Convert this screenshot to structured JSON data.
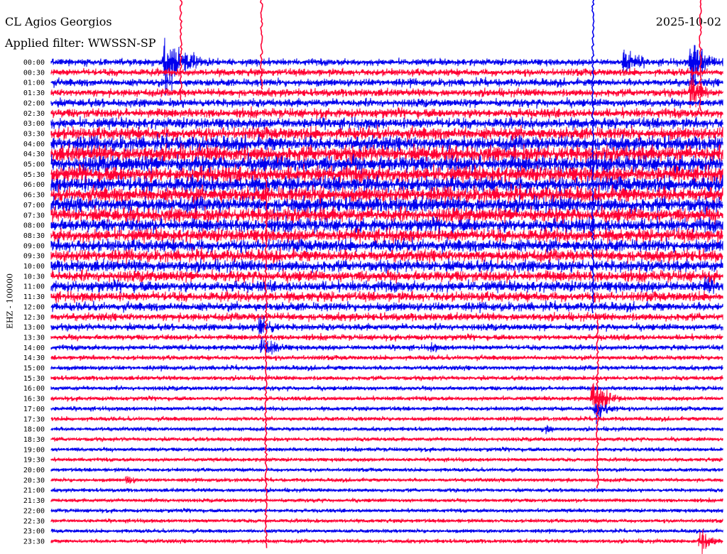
{
  "header": {
    "station": "CL Agios Georgios",
    "filter": "Applied filter: WWSSN-SP",
    "date": "2025-10-02"
  },
  "channel_label": "EHZ - 100000",
  "colors": {
    "trace_a": "#0000ee",
    "trace_b": "#ff0033",
    "background": "#ffffff"
  },
  "chart_data": {
    "type": "line",
    "title": "CL Agios Georgios",
    "subtitle": "Applied filter: WWSSN-SP",
    "date": "2025-10-02",
    "ylabel": "EHZ - 100000",
    "row_interval_minutes": 30,
    "row_labels": [
      "00:00",
      "00:30",
      "01:00",
      "01:30",
      "02:00",
      "02:30",
      "03:00",
      "03:30",
      "04:00",
      "04:30",
      "05:00",
      "05:30",
      "06:00",
      "06:30",
      "07:00",
      "07:30",
      "08:00",
      "08:30",
      "09:00",
      "09:30",
      "10:00",
      "10:30",
      "11:00",
      "11:30",
      "12:00",
      "12:30",
      "13:00",
      "13:30",
      "14:00",
      "14:30",
      "15:00",
      "15:30",
      "16:00",
      "16:30",
      "17:00",
      "17:30",
      "18:00",
      "18:30",
      "19:00",
      "19:30",
      "20:00",
      "20:30",
      "21:00",
      "21:30",
      "22:00",
      "22:30",
      "23:00",
      "23:30"
    ],
    "x_range_minutes": [
      0,
      30
    ],
    "row_noise_amplitude": [
      1.4,
      1.5,
      1.6,
      1.6,
      1.7,
      1.9,
      2.2,
      2.6,
      3.0,
      3.3,
      3.4,
      3.3,
      3.2,
      3.2,
      3.1,
      3.0,
      2.8,
      2.7,
      2.6,
      2.5,
      2.4,
      2.3,
      2.2,
      2.0,
      1.8,
      1.6,
      1.4,
      1.2,
      1.1,
      1.0,
      1.0,
      0.95,
      0.95,
      0.9,
      0.9,
      0.9,
      0.85,
      0.85,
      0.85,
      0.8,
      0.8,
      0.8,
      0.8,
      0.8,
      0.8,
      0.8,
      0.8,
      0.85
    ],
    "events": [
      {
        "row": 0,
        "minute": 5.1,
        "amplitude": 14,
        "duration_min": 2.5
      },
      {
        "row": 0,
        "minute": 25.6,
        "amplitude": 7,
        "duration_min": 2.0
      },
      {
        "row": 0,
        "minute": 28.6,
        "amplitude": 12,
        "duration_min": 2.0
      },
      {
        "row": 3,
        "minute": 28.6,
        "amplitude": 10,
        "duration_min": 1.5
      },
      {
        "row": 13,
        "minute": 12.0,
        "amplitude": 8,
        "duration_min": 1.5
      },
      {
        "row": 22,
        "minute": 29.2,
        "amplitude": 5,
        "duration_min": 1.5
      },
      {
        "row": 26,
        "minute": 9.3,
        "amplitude": 6,
        "duration_min": 2.0
      },
      {
        "row": 28,
        "minute": 9.4,
        "amplitude": 5,
        "duration_min": 2.5
      },
      {
        "row": 28,
        "minute": 17.0,
        "amplitude": 3,
        "duration_min": 1.0
      },
      {
        "row": 33,
        "minute": 24.2,
        "amplitude": 8,
        "duration_min": 2.0
      },
      {
        "row": 34,
        "minute": 24.3,
        "amplitude": 6,
        "duration_min": 2.0
      },
      {
        "row": 36,
        "minute": 22.0,
        "amplitude": 3,
        "duration_min": 1.5
      },
      {
        "row": 39,
        "minute": 31.5,
        "amplitude": 4,
        "duration_min": 2.0
      },
      {
        "row": 41,
        "minute": 3.4,
        "amplitude": 3,
        "duration_min": 1.0
      },
      {
        "row": 47,
        "minute": 29.0,
        "amplitude": 6,
        "duration_min": 1.5
      }
    ],
    "vertical_spikes": [
      {
        "minute": 5.8,
        "row_start": 0,
        "row_end": 3,
        "color": "trace_b"
      },
      {
        "minute": 9.4,
        "row_start": 0,
        "row_end": 2,
        "color": "trace_b"
      },
      {
        "minute": 9.6,
        "row_start": 12,
        "row_end": 47,
        "color": "trace_b"
      },
      {
        "minute": 24.2,
        "row_start": 0,
        "row_end": 24,
        "color": "trace_a"
      },
      {
        "minute": 24.4,
        "row_start": 26,
        "row_end": 41,
        "color": "trace_b"
      },
      {
        "minute": 29.0,
        "row_start": 0,
        "row_end": 4,
        "color": "trace_b"
      },
      {
        "minute": 31.7,
        "row_start": 24,
        "row_end": 47,
        "color": "trace_a"
      }
    ]
  }
}
